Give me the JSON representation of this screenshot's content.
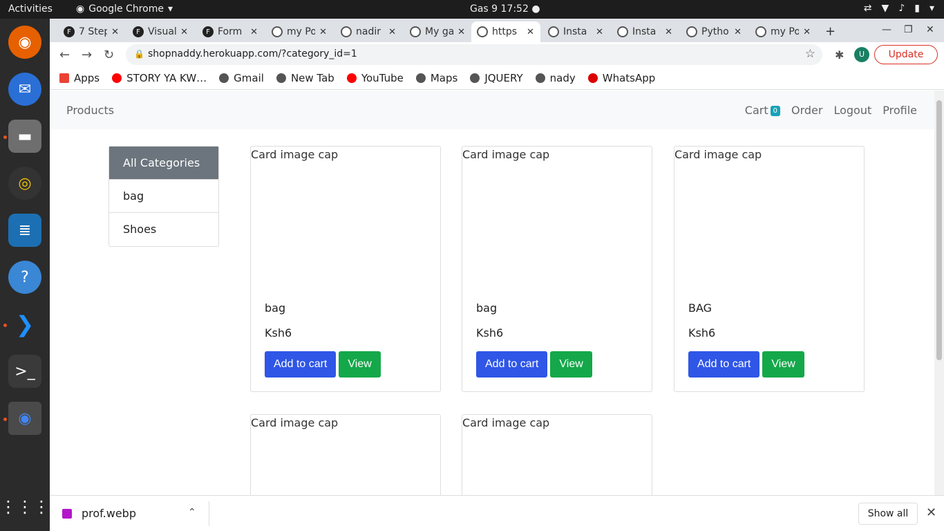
{
  "gnome": {
    "activities": "Activities",
    "app_name": "Google Chrome",
    "clock": "Gas 9  17:52"
  },
  "tabs": [
    {
      "title": "7 Steps",
      "fav": "F"
    },
    {
      "title": "Visual",
      "fav": "F"
    },
    {
      "title": "Form",
      "fav": "F"
    },
    {
      "title": "my Po",
      "fav": ""
    },
    {
      "title": "nadir",
      "fav": ""
    },
    {
      "title": "My ga",
      "fav": ""
    },
    {
      "title": "https",
      "fav": ""
    },
    {
      "title": "Insta",
      "fav": ""
    },
    {
      "title": "Insta",
      "fav": ""
    },
    {
      "title": "Pytho",
      "fav": ""
    },
    {
      "title": "my Po",
      "fav": ""
    }
  ],
  "browser": {
    "url": "shopnaddy.herokuapp.com/?category_id=1",
    "avatar": "U",
    "update_label": "Update"
  },
  "bookmarks": [
    "Apps",
    "STORY YA KW…",
    "Gmail",
    "New Tab",
    "YouTube",
    "Maps",
    "JQUERY",
    "nady",
    "WhatsApp"
  ],
  "navbar": {
    "brand": "Products",
    "cart": "Cart",
    "cart_count": "0",
    "order": "Order",
    "logout": "Logout",
    "profile": "Profile"
  },
  "categories": [
    "All Categories",
    "bag",
    "Shoes"
  ],
  "products": [
    {
      "alt": "Card image cap",
      "name": "bag",
      "price": "Ksh6",
      "add": "Add to cart",
      "view": "View"
    },
    {
      "alt": "Card image cap",
      "name": "bag",
      "price": "Ksh6",
      "add": "Add to cart",
      "view": "View"
    },
    {
      "alt": "Card image cap",
      "name": "BAG",
      "price": "Ksh6",
      "add": "Add to cart",
      "view": "View"
    },
    {
      "alt": "Card image cap"
    },
    {
      "alt": "Card image cap"
    }
  ],
  "downloads": {
    "file": "prof.webp",
    "show_all": "Show all"
  },
  "colors": {
    "add_to_cart": "#2f56e6",
    "view": "#14a84a",
    "active_category": "#6c757d",
    "badge": "#17a2b8"
  }
}
